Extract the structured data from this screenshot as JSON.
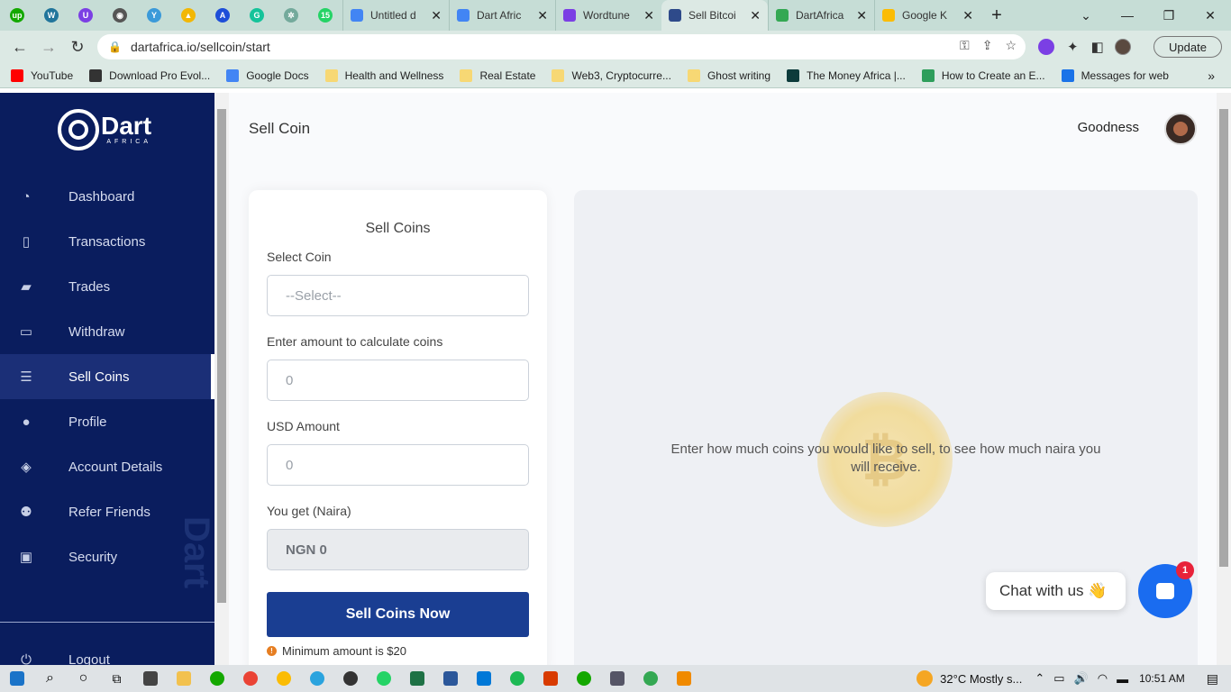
{
  "browser": {
    "tabs": [
      {
        "label": "Untitled d",
        "color": "#4285f4"
      },
      {
        "label": "Dart Afric",
        "color": "#4285f4"
      },
      {
        "label": "Wordtune",
        "color": "#7b3fe4"
      },
      {
        "label": "Sell Bitcoi",
        "color": "#2e4a8a",
        "active": true
      },
      {
        "label": "DartAfrica",
        "color": "#34a853"
      },
      {
        "label": "Google K",
        "color": "#fbbc04"
      }
    ],
    "url": "dartafrica.io/sellcoin/start",
    "update_label": "Update",
    "bookmarks": [
      {
        "label": "YouTube",
        "color": "#ff0000"
      },
      {
        "label": "Download Pro Evol...",
        "color": "#333333"
      },
      {
        "label": "Google Docs",
        "color": "#4285f4"
      },
      {
        "label": "Health and Wellness",
        "color": "#f7d874"
      },
      {
        "label": "Real Estate",
        "color": "#f7d874"
      },
      {
        "label": "Web3, Cryptocurre...",
        "color": "#f7d874"
      },
      {
        "label": "Ghost writing",
        "color": "#f7d874"
      },
      {
        "label": "The Money Africa |...",
        "color": "#0c3b3b"
      },
      {
        "label": "How to Create an E...",
        "color": "#2e9e5b"
      },
      {
        "label": "Messages for web",
        "color": "#1a73e8"
      }
    ]
  },
  "sidebar": {
    "logo_text": "Dart",
    "logo_sub": "AFRICA",
    "items": [
      {
        "label": "Dashboard",
        "icon": "pie-chart-icon"
      },
      {
        "label": "Transactions",
        "icon": "document-icon"
      },
      {
        "label": "Trades",
        "icon": "briefcase-icon"
      },
      {
        "label": "Withdraw",
        "icon": "credit-card-icon"
      },
      {
        "label": "Sell Coins",
        "icon": "coins-icon"
      },
      {
        "label": "Profile",
        "icon": "user-icon"
      },
      {
        "label": "Account Details",
        "icon": "layers-icon"
      },
      {
        "label": "Refer Friends",
        "icon": "users-icon"
      },
      {
        "label": "Security",
        "icon": "lock-icon"
      }
    ],
    "logout_label": "Logout",
    "watermark": "Dart"
  },
  "header": {
    "page_title": "Sell Coin",
    "user_name": "Goodness"
  },
  "form": {
    "title": "Sell Coins",
    "select_label": "Select Coin",
    "select_value": "--Select--",
    "amount_label": "Enter amount to calculate coins",
    "amount_placeholder": "0",
    "usd_label": "USD Amount",
    "usd_placeholder": "0",
    "naira_label": "You get (Naira)",
    "naira_value": "NGN 0",
    "button_label": "Sell Coins Now",
    "min_note": "Minimum amount is $20"
  },
  "result": {
    "message": "Enter how much coins you would like to sell, to see how much naira you will receive."
  },
  "chat": {
    "label": "Chat with us 👋",
    "badge": "1"
  },
  "taskbar": {
    "weather": "32°C  Mostly s...",
    "time": "10:51 AM"
  }
}
